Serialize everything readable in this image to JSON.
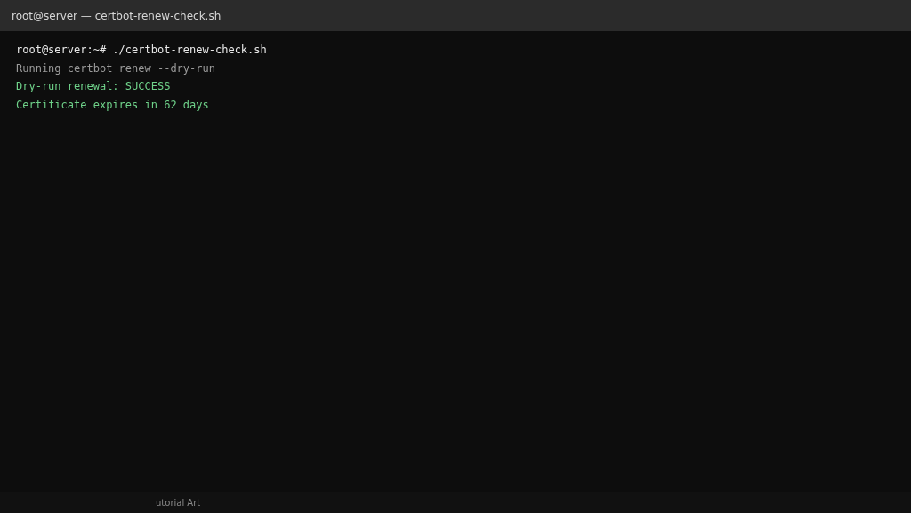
{
  "window": {
    "title": "root@server — certbot-renew-check.sh"
  },
  "terminal": {
    "lines": [
      {
        "kind": "command",
        "text": "root@server:~# ./certbot-renew-check.sh"
      },
      {
        "kind": "info",
        "text": "Running certbot renew --dry-run"
      },
      {
        "kind": "success",
        "text": "Dry-run renewal: SUCCESS"
      },
      {
        "kind": "success",
        "text": "Certificate expires in 62 days"
      }
    ]
  },
  "footer": {
    "text": "utorial Art"
  }
}
